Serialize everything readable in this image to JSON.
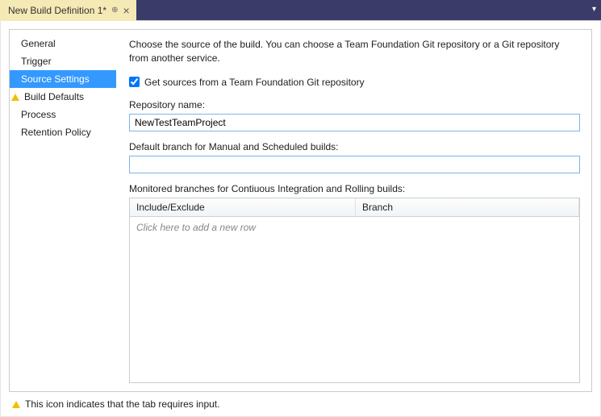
{
  "tab": {
    "title": "New Build Definition 1*"
  },
  "sidebar": {
    "items": [
      {
        "label": "General"
      },
      {
        "label": "Trigger"
      },
      {
        "label": "Source Settings"
      },
      {
        "label": "Build Defaults"
      },
      {
        "label": "Process"
      },
      {
        "label": "Retention Policy"
      }
    ]
  },
  "main": {
    "description": "Choose the source of the build. You can choose a Team Foundation Git repository or a Git repository from another service.",
    "checkbox_label": "Get sources from a Team Foundation Git repository",
    "repo_label": "Repository name:",
    "repo_value": "NewTestTeamProject",
    "branch_label": "Default branch for Manual and Scheduled builds:",
    "branch_value": "",
    "monitored_label": "Monitored branches for Contiuous Integration and Rolling builds:",
    "grid": {
      "col1": "Include/Exclude",
      "col2": "Branch",
      "placeholder": "Click here to add a new row"
    }
  },
  "footer": {
    "text": "This icon indicates that the tab requires input."
  }
}
